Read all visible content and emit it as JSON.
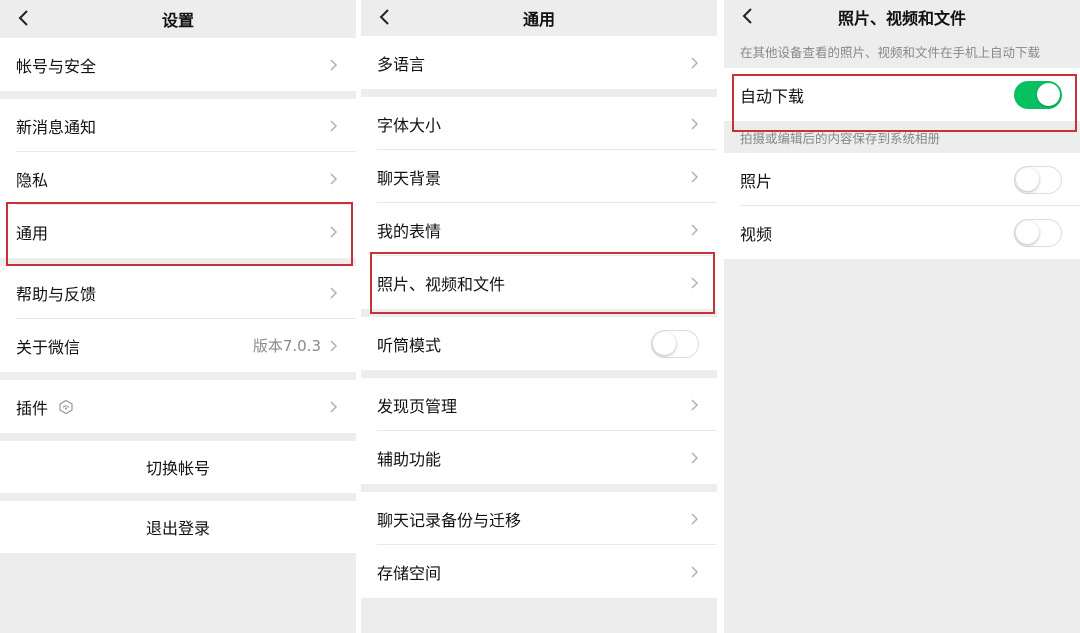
{
  "settings": {
    "title": "设置",
    "items": {
      "account": "帐号与安全",
      "notify": "新消息通知",
      "privacy": "隐私",
      "general": "通用",
      "help": "帮助与反馈",
      "about": "关于微信",
      "about_version": "版本7.0.3",
      "plugins": "插件"
    },
    "switch_account": "切换帐号",
    "logout": "退出登录"
  },
  "general": {
    "title": "通用",
    "items": {
      "language": "多语言",
      "font": "字体大小",
      "chat_bg": "聊天背景",
      "stickers": "我的表情",
      "media": "照片、视频和文件",
      "earpiece": "听筒模式",
      "discover": "发现页管理",
      "accessibility": "辅助功能",
      "backup": "聊天记录备份与迁移",
      "storage": "存储空间"
    },
    "earpiece_on": false
  },
  "media": {
    "title": "照片、视频和文件",
    "note_download": "在其他设备查看的照片、视频和文件在手机上自动下载",
    "auto_download": "自动下载",
    "auto_download_on": true,
    "note_save": "拍摄或编辑后的内容保存到系统相册",
    "photos": "照片",
    "photos_on": false,
    "videos": "视频",
    "videos_on": false
  },
  "colors": {
    "background": "#ededed",
    "toggle_on": "#07c160",
    "highlight": "#c8303a"
  },
  "icons": [
    "back-chevron-icon",
    "chevron-right-icon",
    "plugin-hexagon-icon"
  ]
}
